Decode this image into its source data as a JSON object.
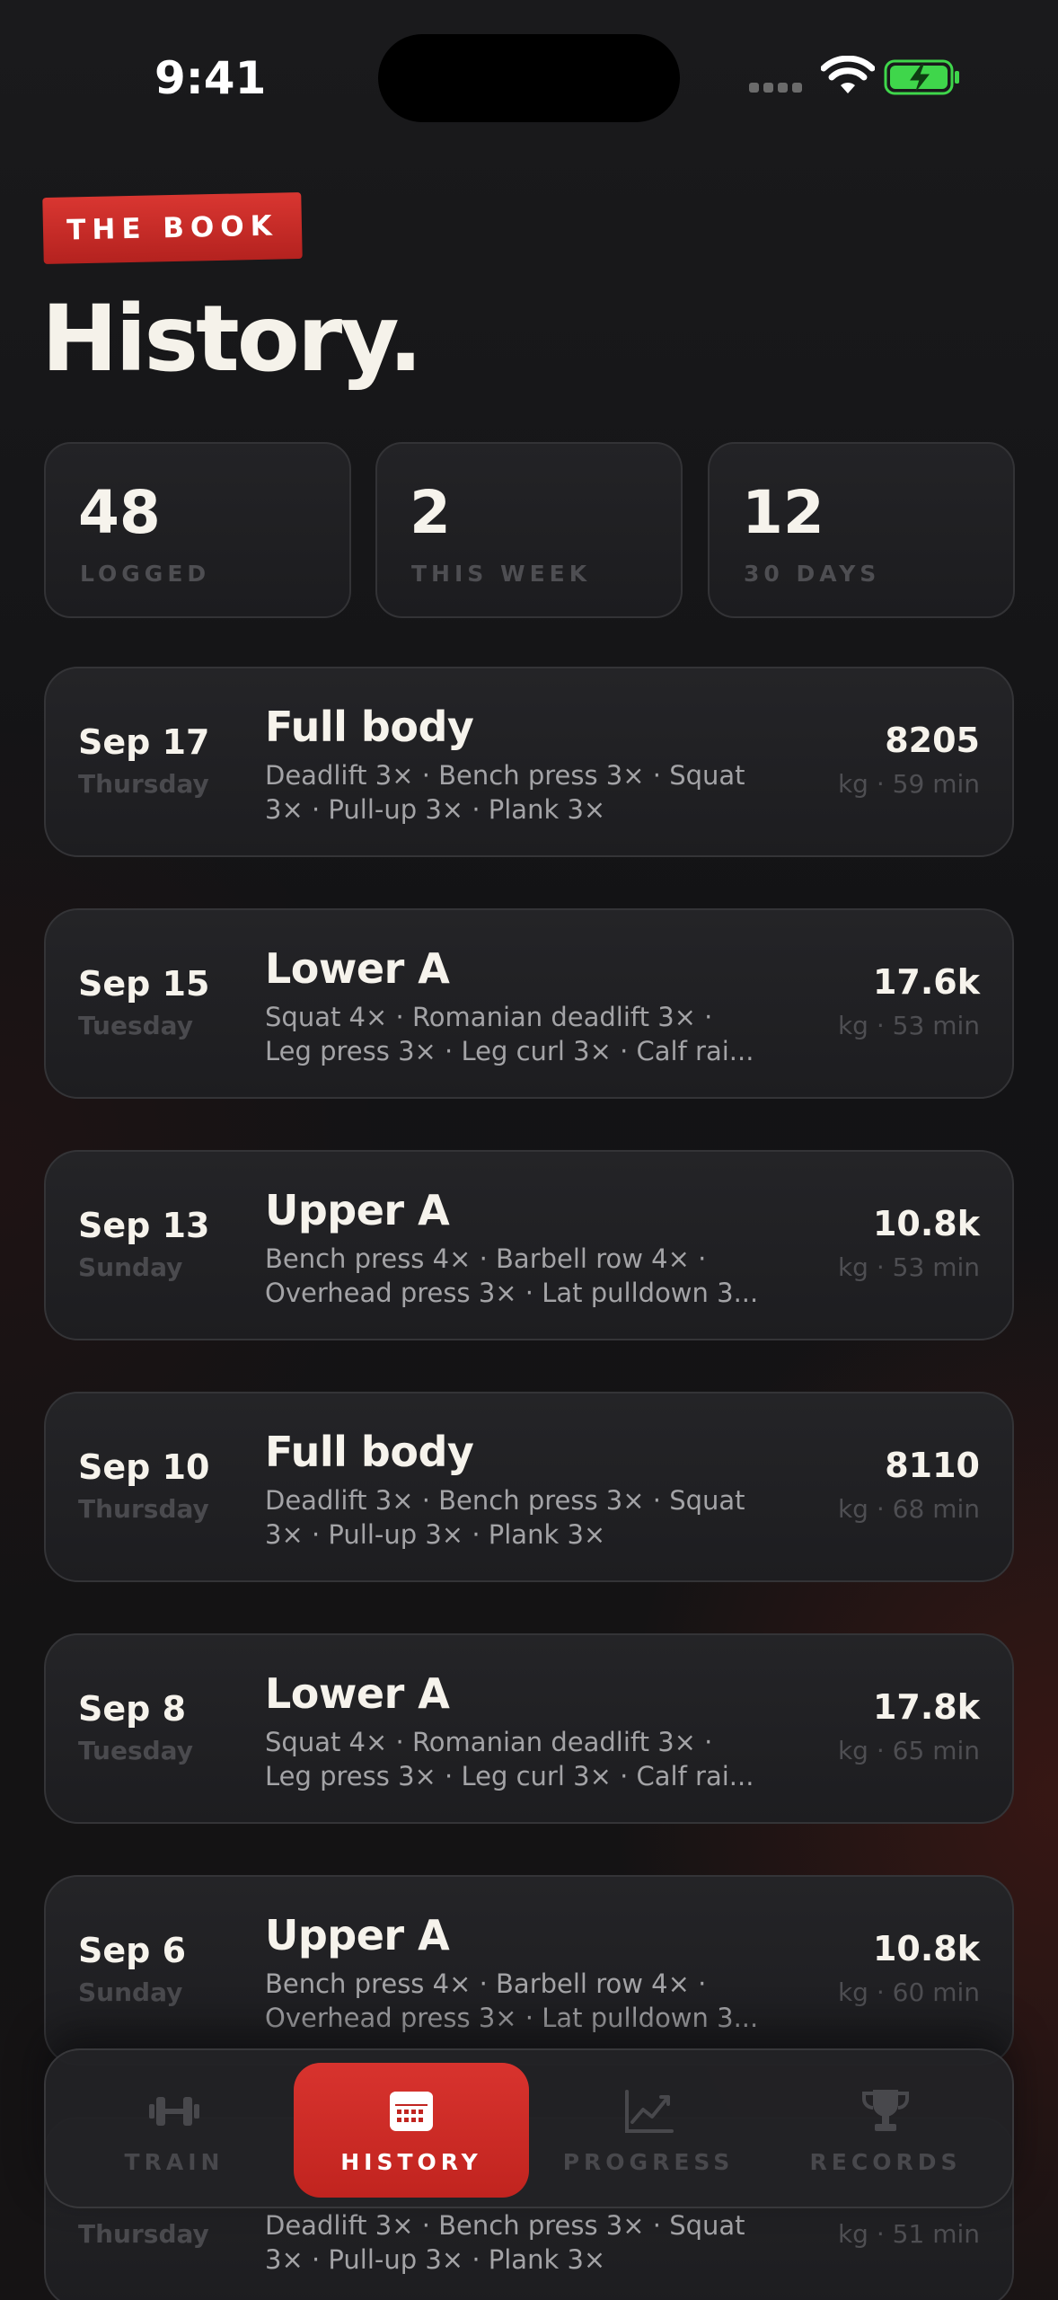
{
  "status_bar": {
    "time": "9:41"
  },
  "header": {
    "tag": "THE BOOK",
    "title": "History."
  },
  "stats": [
    {
      "value": "48",
      "label": "LOGGED"
    },
    {
      "value": "2",
      "label": "THIS WEEK"
    },
    {
      "value": "12",
      "label": "30 DAYS"
    }
  ],
  "workouts": [
    {
      "date": "Sep 17",
      "day": "Thursday",
      "title": "Full body",
      "exercises_line1": "Deadlift 3× · Bench press 3× · Squat",
      "exercises_line2": "3× · Pull-up 3× · Plank 3×",
      "volume": "8205",
      "meta": "kg · 59 min"
    },
    {
      "date": "Sep 15",
      "day": "Tuesday",
      "title": "Lower A",
      "exercises_line1": "Squat 4× · Romanian deadlift 3× ·",
      "exercises_line2": "Leg press 3× · Leg curl 3× · Calf rai...",
      "volume": "17.6k",
      "meta": "kg · 53 min"
    },
    {
      "date": "Sep 13",
      "day": "Sunday",
      "title": "Upper A",
      "exercises_line1": "Bench press 4× · Barbell row 4× ·",
      "exercises_line2": "Overhead press 3× · Lat pulldown 3...",
      "volume": "10.8k",
      "meta": "kg · 53 min"
    },
    {
      "date": "Sep 10",
      "day": "Thursday",
      "title": "Full body",
      "exercises_line1": "Deadlift 3× · Bench press 3× · Squat",
      "exercises_line2": "3× · Pull-up 3× · Plank 3×",
      "volume": "8110",
      "meta": "kg · 68 min"
    },
    {
      "date": "Sep 8",
      "day": "Tuesday",
      "title": "Lower A",
      "exercises_line1": "Squat 4× · Romanian deadlift 3× ·",
      "exercises_line2": "Leg press 3× · Leg curl 3× · Calf rai...",
      "volume": "17.8k",
      "meta": "kg · 65 min"
    },
    {
      "date": "Sep 6",
      "day": "Sunday",
      "title": "Upper A",
      "exercises_line1": "Bench press 4× · Barbell row 4× ·",
      "exercises_line2": "Overhead press 3× · Lat pulldown 3...",
      "volume": "10.8k",
      "meta": "kg · 60 min"
    },
    {
      "date": "",
      "day": "Thursday",
      "title": "",
      "exercises_line1": "Deadlift 3× · Bench press 3× · Squat",
      "exercises_line2": "3× · Pull-up 3× · Plank 3×",
      "volume": "",
      "meta": "kg · 51 min"
    }
  ],
  "tabbar": {
    "tabs": [
      {
        "label": "TRAIN",
        "icon": "dumbbell-icon",
        "active": false
      },
      {
        "label": "HISTORY",
        "icon": "calendar-icon",
        "active": true
      },
      {
        "label": "PROGRESS",
        "icon": "chart-line-icon",
        "active": false
      },
      {
        "label": "RECORDS",
        "icon": "trophy-icon",
        "active": false
      }
    ]
  },
  "colors": {
    "accent": "#d32f2a",
    "background": "#141416",
    "card": "#222225",
    "muted_text": "#4e4e52",
    "battery": "#3fd64b"
  }
}
